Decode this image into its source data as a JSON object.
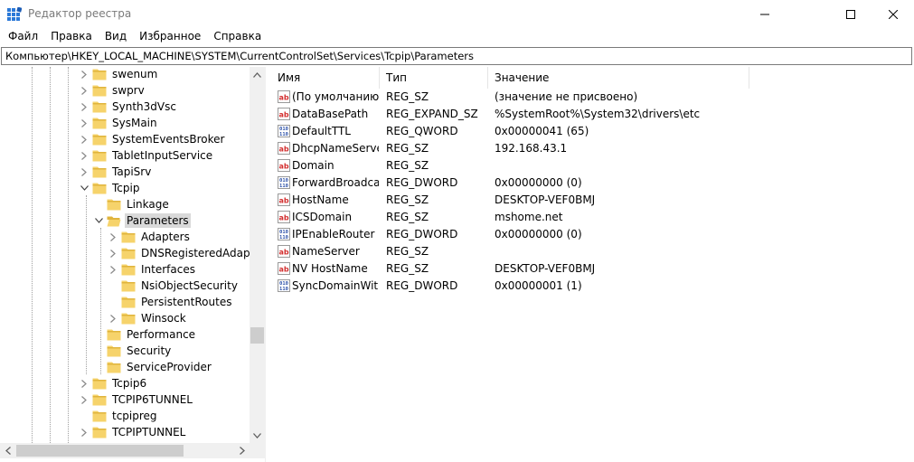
{
  "window": {
    "title": "Редактор реестра",
    "icon": "registry-editor-icon"
  },
  "menu": {
    "items": [
      "Файл",
      "Правка",
      "Вид",
      "Избранное",
      "Справка"
    ]
  },
  "address": {
    "path": "Компьютер\\HKEY_LOCAL_MACHINE\\SYSTEM\\CurrentControlSet\\Services\\Tcpip\\Parameters"
  },
  "tree": {
    "items": [
      {
        "label": "swenum"
      },
      {
        "label": "swprv"
      },
      {
        "label": "Synth3dVsc"
      },
      {
        "label": "SysMain"
      },
      {
        "label": "SystemEventsBroker"
      },
      {
        "label": "TabletInputService"
      },
      {
        "label": "TapiSrv"
      },
      {
        "label": "Tcpip"
      },
      {
        "label": "Linkage"
      },
      {
        "label": "Parameters"
      },
      {
        "label": "Adapters"
      },
      {
        "label": "DNSRegisteredAdapters"
      },
      {
        "label": "Interfaces"
      },
      {
        "label": "NsiObjectSecurity"
      },
      {
        "label": "PersistentRoutes"
      },
      {
        "label": "Winsock"
      },
      {
        "label": "Performance"
      },
      {
        "label": "Security"
      },
      {
        "label": "ServiceProvider"
      },
      {
        "label": "Tcpip6"
      },
      {
        "label": "TCPIP6TUNNEL"
      },
      {
        "label": "tcpipreg"
      },
      {
        "label": "TCPIPTUNNEL"
      }
    ]
  },
  "list": {
    "columns": [
      "Имя",
      "Тип",
      "Значение"
    ],
    "rows": [
      {
        "name": "(По умолчанию)",
        "type": "REG_SZ",
        "value": "(значение не присвоено)",
        "icon": "string-value-icon"
      },
      {
        "name": "DataBasePath",
        "type": "REG_EXPAND_SZ",
        "value": "%SystemRoot%\\System32\\drivers\\etc",
        "icon": "string-value-icon"
      },
      {
        "name": "DefaultTTL",
        "type": "REG_QWORD",
        "value": "0x00000041 (65)",
        "icon": "binary-value-icon"
      },
      {
        "name": "DhcpNameServer",
        "type": "REG_SZ",
        "value": "192.168.43.1",
        "icon": "string-value-icon"
      },
      {
        "name": "Domain",
        "type": "REG_SZ",
        "value": "",
        "icon": "string-value-icon"
      },
      {
        "name": "ForwardBroadca...",
        "type": "REG_DWORD",
        "value": "0x00000000 (0)",
        "icon": "binary-value-icon"
      },
      {
        "name": "HostName",
        "type": "REG_SZ",
        "value": "DESKTOP-VEF0BMJ",
        "icon": "string-value-icon"
      },
      {
        "name": "ICSDomain",
        "type": "REG_SZ",
        "value": "mshome.net",
        "icon": "string-value-icon"
      },
      {
        "name": "IPEnableRouter",
        "type": "REG_DWORD",
        "value": "0x00000000 (0)",
        "icon": "binary-value-icon"
      },
      {
        "name": "NameServer",
        "type": "REG_SZ",
        "value": "",
        "icon": "string-value-icon"
      },
      {
        "name": "NV HostName",
        "type": "REG_SZ",
        "value": "DESKTOP-VEF0BMJ",
        "icon": "string-value-icon"
      },
      {
        "name": "SyncDomainWit...",
        "type": "REG_DWORD",
        "value": "0x00000001 (1)",
        "icon": "binary-value-icon"
      }
    ]
  },
  "colors": {
    "folder": "#f6d36b",
    "folder_dark": "#e0b43c",
    "selected": "#d9d9d9",
    "icon_string": "#d32f2f",
    "icon_binary": "#2a4fa8"
  }
}
